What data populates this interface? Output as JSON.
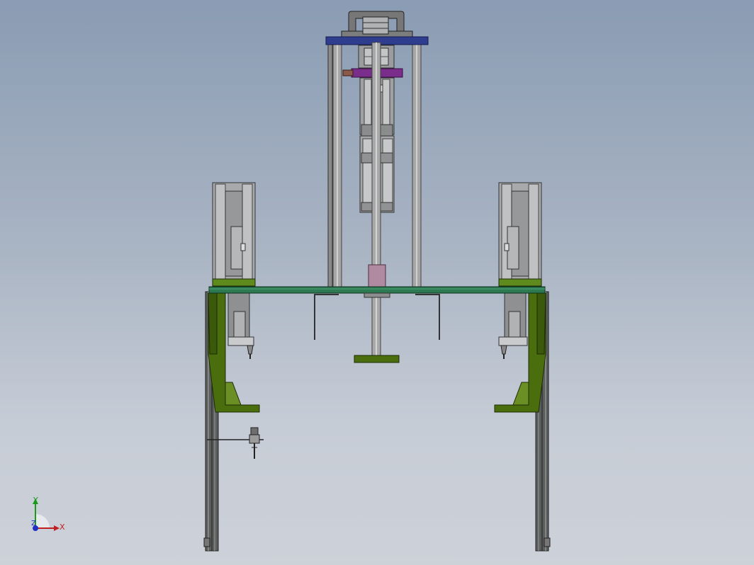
{
  "triad": {
    "x_label": "X",
    "y_label": "Y",
    "z_label": "Z"
  },
  "colors": {
    "background_top": "#8a9cb3",
    "background_bottom": "#cdd1d8",
    "main_plate": "#2d7a52",
    "bracket_green": "#4a6e0e",
    "top_plate_blue": "#2f3d8f",
    "purple_block": "#7a2d8a",
    "rod_gray": "#a6a6a6",
    "pink_bushing": "#b08aa0",
    "axis_x": "#c02020",
    "axis_y": "#1a9a1a",
    "axis_z": "#2030c0"
  }
}
